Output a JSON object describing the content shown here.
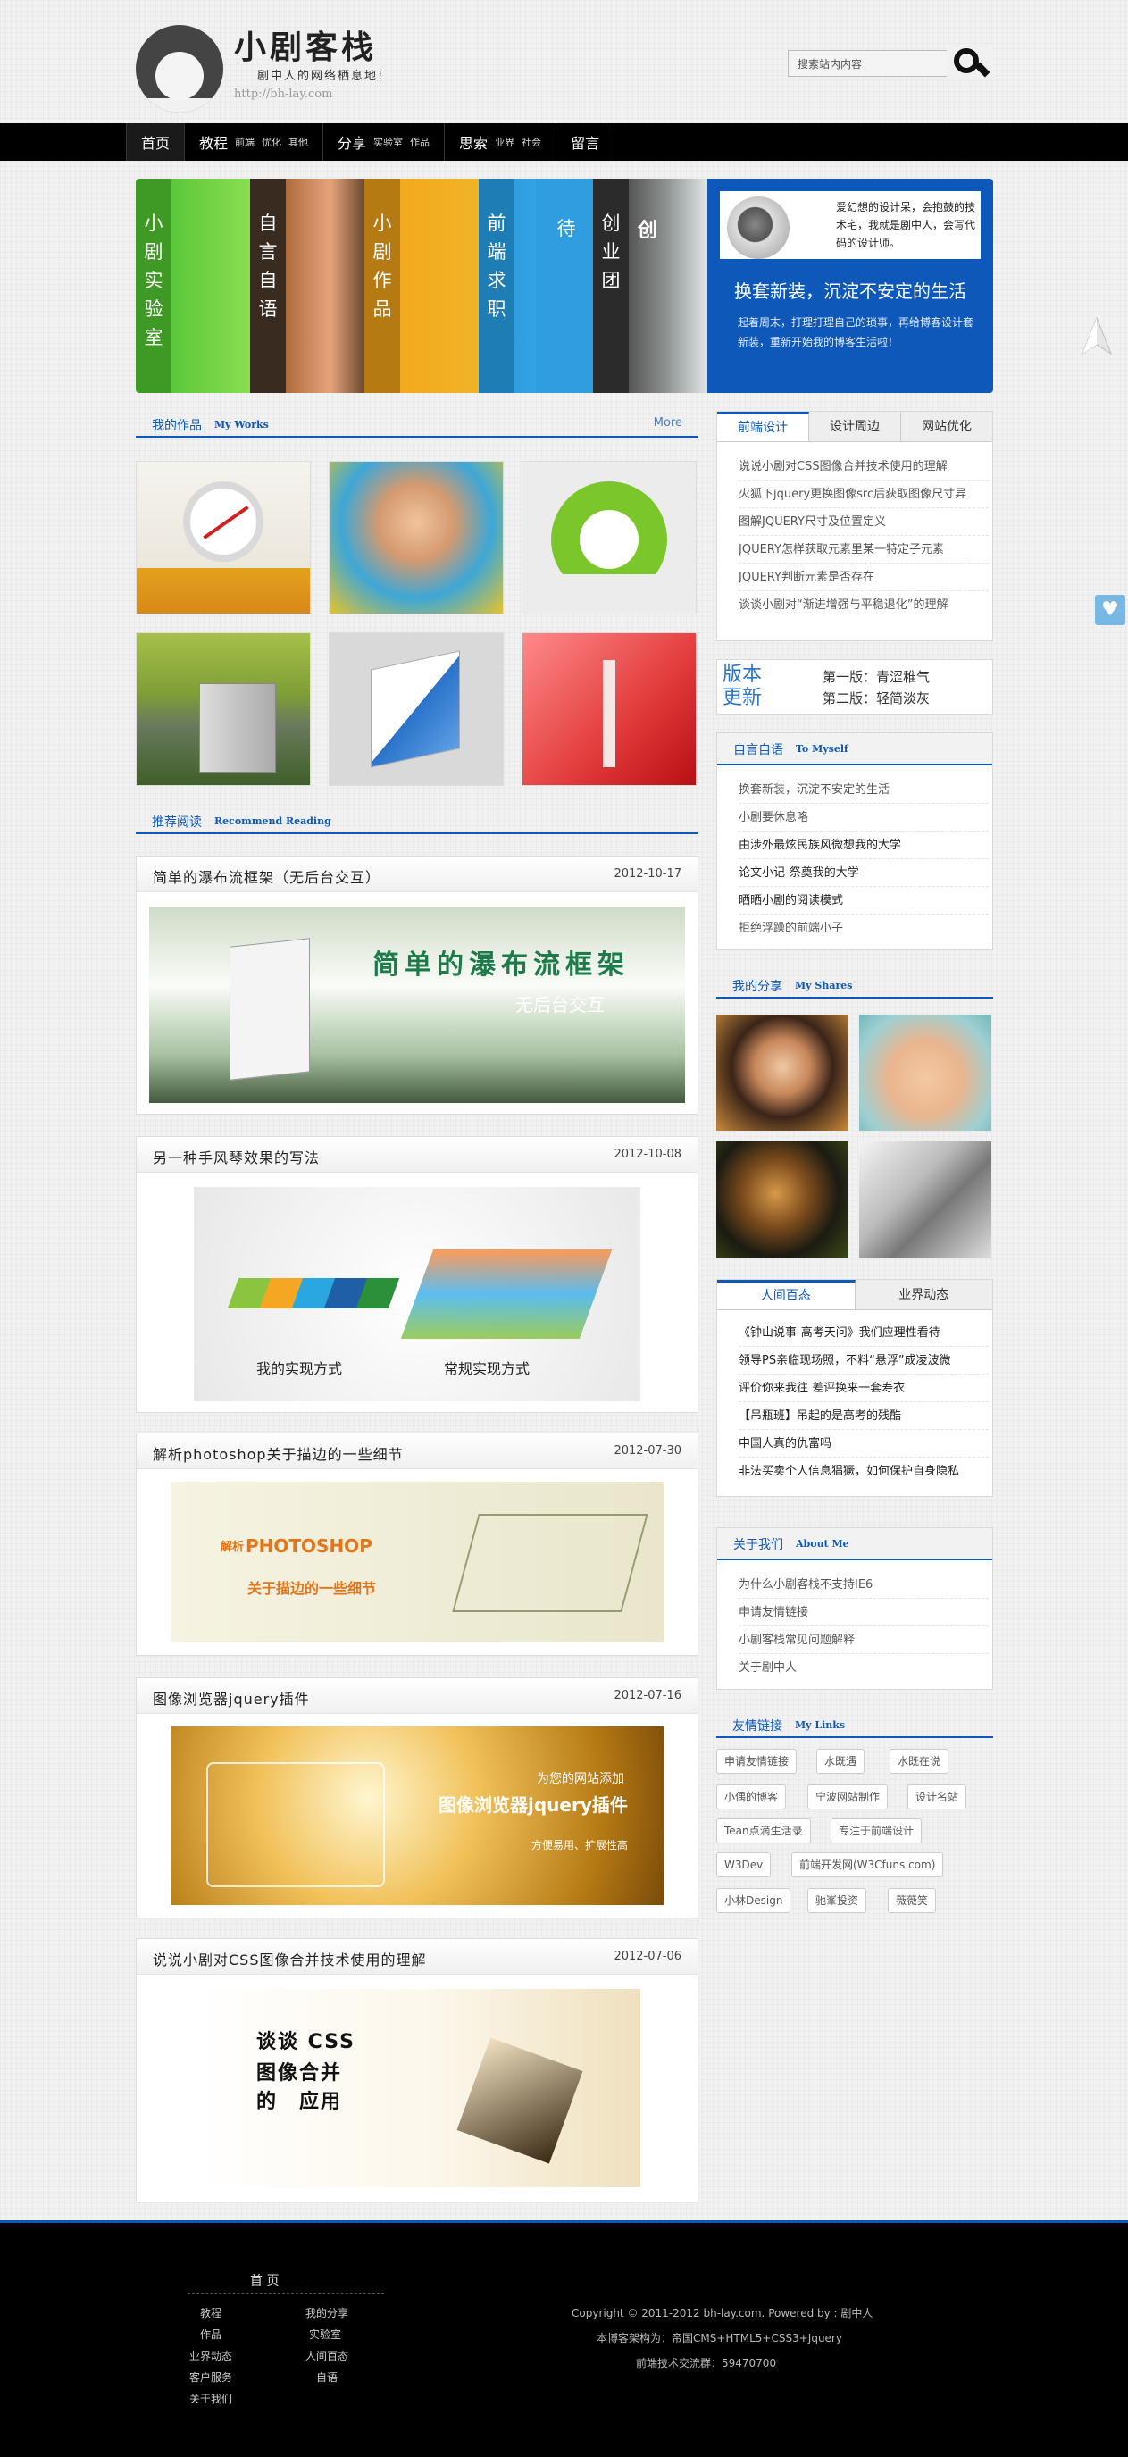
{
  "header": {
    "title": "小剧客栈",
    "slogan": "剧中人的网络栖息地!",
    "url": "http://bh-lay.com",
    "search_placeholder": "搜索站内内容"
  },
  "nav": [
    {
      "label": "首页",
      "subs": []
    },
    {
      "label": "教程",
      "subs": [
        "前端",
        "优化",
        "其他"
      ]
    },
    {
      "label": "分享",
      "subs": [
        "实验室",
        "作品"
      ]
    },
    {
      "label": "思索",
      "subs": [
        "业界",
        "社会"
      ]
    },
    {
      "label": "留言",
      "subs": []
    }
  ],
  "banner": {
    "panels": [
      "小剧实验室",
      "自言自语",
      "小剧作品",
      "前端求职",
      "待",
      "创业团"
    ],
    "partial_title": "创",
    "card_text": "爱幻想的设计呆，会抱鼓的技术宅，我就是剧中人，会写代码的设计师。",
    "title": "换套新装，沉淀不安定的生活",
    "desc": "起着周末，打理打理自己的琐事，再给博客设计套新装，重新开始我的博客生活啦！"
  },
  "works": {
    "title": "我的作品",
    "en": "My Works",
    "more": "More"
  },
  "recommend": {
    "title": "推荐阅读",
    "en": "Recommend Reading"
  },
  "articles": [
    {
      "title": "简单的瀑布流框架（无后台交互）",
      "date": "2012-10-17",
      "img_main": "简单的瀑布流框架",
      "img_sub": "无后台交互"
    },
    {
      "title": "另一种手风琴效果的写法",
      "date": "2012-10-08",
      "img_main": "我的实现方式",
      "img_sub": "常规实现方式"
    },
    {
      "title": "解析photoshop关于描边的一些细节",
      "date": "2012-07-30",
      "img_main": "PHOTOSHOP",
      "img_sub": "关于描边的一些细节",
      "img_tag": "解析"
    },
    {
      "title": "图像浏览器jquery插件",
      "date": "2012-07-16",
      "img_main": "图像浏览器jquery插件",
      "img_sub": "为您的网站添加",
      "img_tag": "方便易用、扩展性高"
    },
    {
      "title": "说说小剧对CSS图像合并技术使用的理解",
      "date": "2012-07-06",
      "img_main": "谈谈 CSS",
      "img_sub": "图像合并",
      "img_tag": "的　应用"
    }
  ],
  "sidebar": {
    "tabs1": [
      "前端设计",
      "设计周边",
      "网站优化"
    ],
    "list1": [
      "说说小剧对CSS图像合并技术使用的理解",
      "火狐下jquery更换图像src后获取图像尺寸异",
      "图解JQUERY尺寸及位置定义",
      "JQUERY怎样获取元素里某一特定子元素",
      "JQUERY判断元素是否存在",
      "谈谈小剧对“渐进增强与平稳退化”的理解"
    ],
    "version": {
      "label": "版本更新",
      "v1": "第一版：青涩稚气",
      "v2": "第二版：轻简淡灰"
    },
    "myself": {
      "title": "自言自语",
      "en": "To Myself",
      "items": [
        "换套新装，沉淀不安定的生活",
        "小剧要休息咯",
        "由涉外最炫民族风微想我的大学",
        "论文小记-祭奠我的大学",
        "晒晒小剧的阅读模式",
        "拒绝浮躁的前端小子"
      ]
    },
    "shares": {
      "title": "我的分享",
      "en": "My Shares"
    },
    "tabs2": [
      "人间百态",
      "业界动态"
    ],
    "list2": [
      "《钟山说事-高考天问》我们应理性看待",
      "领导PS亲临现场照，不料“悬浮”成凌波微",
      "评价你来我往 差评换来一套寿衣",
      "【吊瓶班】吊起的是高考的残酷",
      "中国人真的仇富吗",
      "非法买卖个人信息猖獗，如何保护自身隐私"
    ],
    "about": {
      "title": "关于我们",
      "en": "About Me",
      "items": [
        "为什么小剧客栈不支持IE6",
        "申请友情链接",
        "小剧客栈常见问题解释",
        "关于剧中人"
      ]
    },
    "links": {
      "title": "友情链接",
      "en": "My Links",
      "items": [
        "申请友情链接",
        "水既遇",
        "水既在说",
        "小偶的博客",
        "宁波网站制作",
        "设计名站",
        "Tean点滴生活录",
        "专注于前端设计",
        "W3Dev",
        "前端开发网(W3Cfuns.com)",
        "小林Design",
        "驰峯投资",
        "薇薇笑"
      ]
    }
  },
  "footer": {
    "home": "首 页",
    "left": [
      "教程",
      "作品",
      "业界动态",
      "客户服务",
      "关于我们"
    ],
    "right": [
      "我的分享",
      "实验室",
      "人间百态",
      "自语"
    ],
    "copyright": "Copyright © 2011-2012 bh-lay.com. Powered by : 剧中人",
    "arch": "本博客架构为：帝国CMS+HTML5+CSS3+Jquery",
    "group": "前端技术交流群：59470700"
  },
  "colors": {
    "accent": "#0d58b9",
    "nav_bg": "#000000",
    "footer_bg": "#000000"
  }
}
